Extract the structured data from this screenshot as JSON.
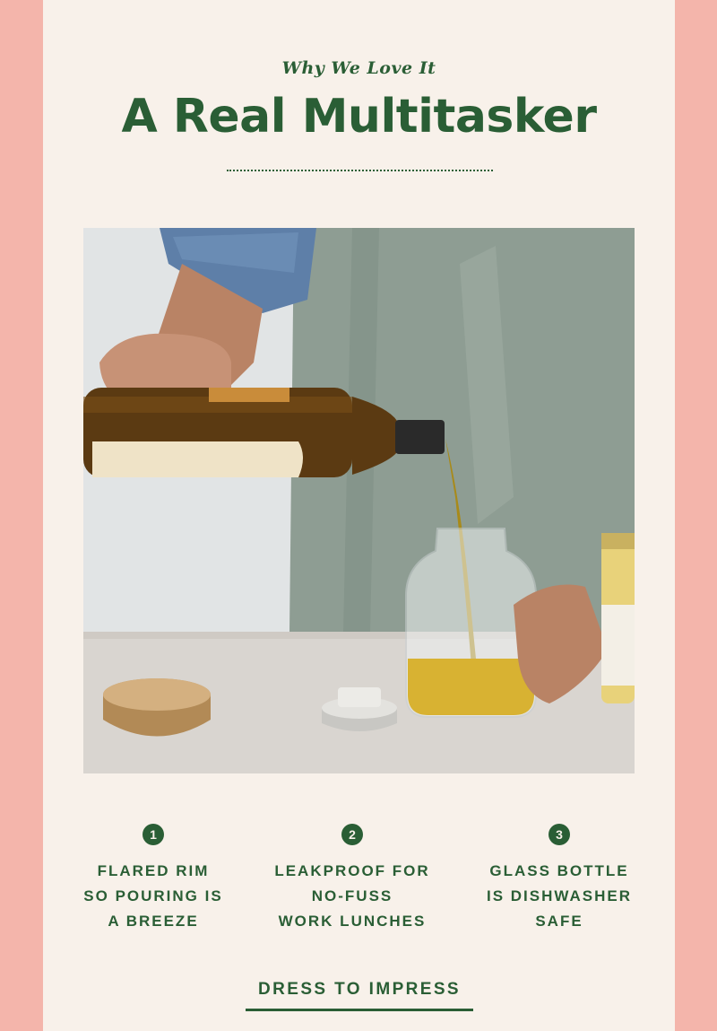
{
  "header": {
    "eyebrow": "Why We Love It",
    "title": "A Real Multitasker"
  },
  "photo": {
    "subject": "bottle-pouring-oil-into-glass-jar"
  },
  "features": [
    {
      "number": "1",
      "label": "FLARED RIM\nSO POURING IS\nA BREEZE"
    },
    {
      "number": "2",
      "label": "LEAKPROOF FOR\nNO-FUSS\nWORK LUNCHES"
    },
    {
      "number": "3",
      "label": "GLASS BOTTLE\nIS DISHWASHER\nSAFE"
    }
  ],
  "cta": {
    "label": "DRESS TO IMPRESS"
  },
  "colors": {
    "accent_green": "#2a5e35",
    "side_pink": "#f4b5ab",
    "panel_cream": "#f8f1ea"
  }
}
